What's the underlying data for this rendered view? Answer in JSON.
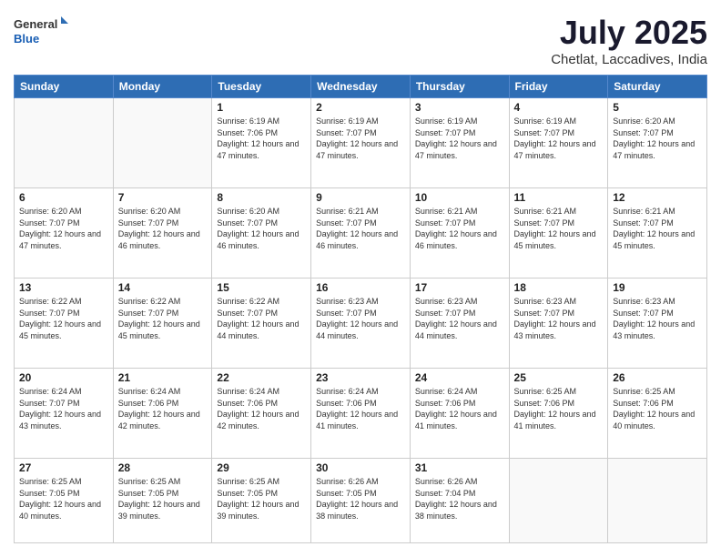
{
  "header": {
    "logo_general": "General",
    "logo_blue": "Blue",
    "month_title": "July 2025",
    "location": "Chetlat, Laccadives, India"
  },
  "days_of_week": [
    "Sunday",
    "Monday",
    "Tuesday",
    "Wednesday",
    "Thursday",
    "Friday",
    "Saturday"
  ],
  "weeks": [
    [
      {
        "day": "",
        "info": ""
      },
      {
        "day": "",
        "info": ""
      },
      {
        "day": "1",
        "info": "Sunrise: 6:19 AM\nSunset: 7:06 PM\nDaylight: 12 hours and 47 minutes."
      },
      {
        "day": "2",
        "info": "Sunrise: 6:19 AM\nSunset: 7:07 PM\nDaylight: 12 hours and 47 minutes."
      },
      {
        "day": "3",
        "info": "Sunrise: 6:19 AM\nSunset: 7:07 PM\nDaylight: 12 hours and 47 minutes."
      },
      {
        "day": "4",
        "info": "Sunrise: 6:19 AM\nSunset: 7:07 PM\nDaylight: 12 hours and 47 minutes."
      },
      {
        "day": "5",
        "info": "Sunrise: 6:20 AM\nSunset: 7:07 PM\nDaylight: 12 hours and 47 minutes."
      }
    ],
    [
      {
        "day": "6",
        "info": "Sunrise: 6:20 AM\nSunset: 7:07 PM\nDaylight: 12 hours and 47 minutes."
      },
      {
        "day": "7",
        "info": "Sunrise: 6:20 AM\nSunset: 7:07 PM\nDaylight: 12 hours and 46 minutes."
      },
      {
        "day": "8",
        "info": "Sunrise: 6:20 AM\nSunset: 7:07 PM\nDaylight: 12 hours and 46 minutes."
      },
      {
        "day": "9",
        "info": "Sunrise: 6:21 AM\nSunset: 7:07 PM\nDaylight: 12 hours and 46 minutes."
      },
      {
        "day": "10",
        "info": "Sunrise: 6:21 AM\nSunset: 7:07 PM\nDaylight: 12 hours and 46 minutes."
      },
      {
        "day": "11",
        "info": "Sunrise: 6:21 AM\nSunset: 7:07 PM\nDaylight: 12 hours and 45 minutes."
      },
      {
        "day": "12",
        "info": "Sunrise: 6:21 AM\nSunset: 7:07 PM\nDaylight: 12 hours and 45 minutes."
      }
    ],
    [
      {
        "day": "13",
        "info": "Sunrise: 6:22 AM\nSunset: 7:07 PM\nDaylight: 12 hours and 45 minutes."
      },
      {
        "day": "14",
        "info": "Sunrise: 6:22 AM\nSunset: 7:07 PM\nDaylight: 12 hours and 45 minutes."
      },
      {
        "day": "15",
        "info": "Sunrise: 6:22 AM\nSunset: 7:07 PM\nDaylight: 12 hours and 44 minutes."
      },
      {
        "day": "16",
        "info": "Sunrise: 6:23 AM\nSunset: 7:07 PM\nDaylight: 12 hours and 44 minutes."
      },
      {
        "day": "17",
        "info": "Sunrise: 6:23 AM\nSunset: 7:07 PM\nDaylight: 12 hours and 44 minutes."
      },
      {
        "day": "18",
        "info": "Sunrise: 6:23 AM\nSunset: 7:07 PM\nDaylight: 12 hours and 43 minutes."
      },
      {
        "day": "19",
        "info": "Sunrise: 6:23 AM\nSunset: 7:07 PM\nDaylight: 12 hours and 43 minutes."
      }
    ],
    [
      {
        "day": "20",
        "info": "Sunrise: 6:24 AM\nSunset: 7:07 PM\nDaylight: 12 hours and 43 minutes."
      },
      {
        "day": "21",
        "info": "Sunrise: 6:24 AM\nSunset: 7:06 PM\nDaylight: 12 hours and 42 minutes."
      },
      {
        "day": "22",
        "info": "Sunrise: 6:24 AM\nSunset: 7:06 PM\nDaylight: 12 hours and 42 minutes."
      },
      {
        "day": "23",
        "info": "Sunrise: 6:24 AM\nSunset: 7:06 PM\nDaylight: 12 hours and 41 minutes."
      },
      {
        "day": "24",
        "info": "Sunrise: 6:24 AM\nSunset: 7:06 PM\nDaylight: 12 hours and 41 minutes."
      },
      {
        "day": "25",
        "info": "Sunrise: 6:25 AM\nSunset: 7:06 PM\nDaylight: 12 hours and 41 minutes."
      },
      {
        "day": "26",
        "info": "Sunrise: 6:25 AM\nSunset: 7:06 PM\nDaylight: 12 hours and 40 minutes."
      }
    ],
    [
      {
        "day": "27",
        "info": "Sunrise: 6:25 AM\nSunset: 7:05 PM\nDaylight: 12 hours and 40 minutes."
      },
      {
        "day": "28",
        "info": "Sunrise: 6:25 AM\nSunset: 7:05 PM\nDaylight: 12 hours and 39 minutes."
      },
      {
        "day": "29",
        "info": "Sunrise: 6:25 AM\nSunset: 7:05 PM\nDaylight: 12 hours and 39 minutes."
      },
      {
        "day": "30",
        "info": "Sunrise: 6:26 AM\nSunset: 7:05 PM\nDaylight: 12 hours and 38 minutes."
      },
      {
        "day": "31",
        "info": "Sunrise: 6:26 AM\nSunset: 7:04 PM\nDaylight: 12 hours and 38 minutes."
      },
      {
        "day": "",
        "info": ""
      },
      {
        "day": "",
        "info": ""
      }
    ]
  ]
}
